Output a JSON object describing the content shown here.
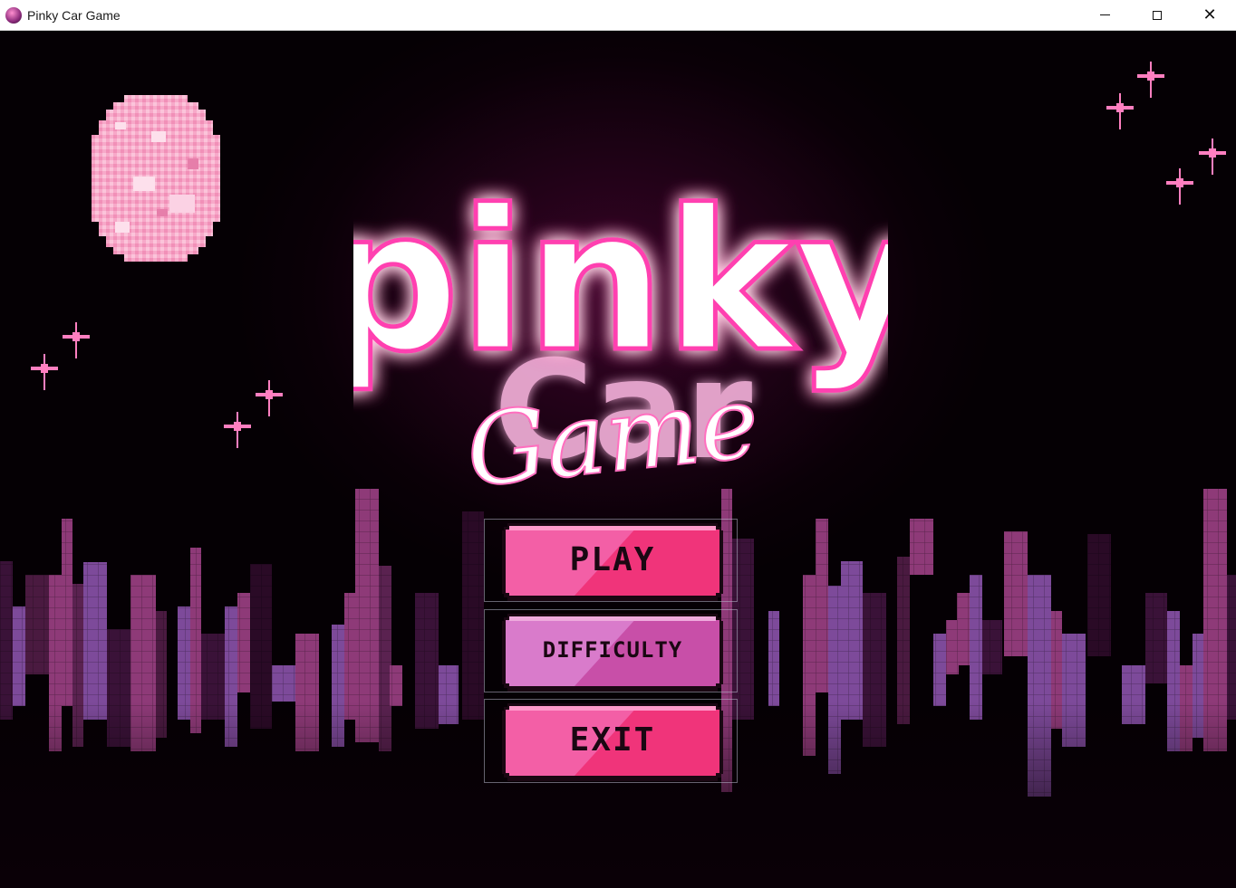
{
  "window": {
    "title": "Pinky Car Game",
    "controls": [
      "minimize",
      "maximize",
      "close"
    ]
  },
  "game": {
    "logo": {
      "line1": "pinky",
      "line2": "Car",
      "line3": "Game"
    },
    "menu": [
      {
        "id": "play",
        "label": "PLAY"
      },
      {
        "id": "difficulty",
        "label": "DIFFICULTY"
      },
      {
        "id": "exit",
        "label": "EXIT"
      }
    ],
    "colors": {
      "background": "#0a0007",
      "accent_pink": "#f0347a",
      "button_pink": "#f35fa6",
      "button_lilac": "#d97bcb",
      "moon": "#f7a9c9",
      "sparkle": "#ff7fc0",
      "glow": "#ff3fb0"
    },
    "icons": [
      "app-icon",
      "moon-icon",
      "sparkle-icon"
    ]
  }
}
